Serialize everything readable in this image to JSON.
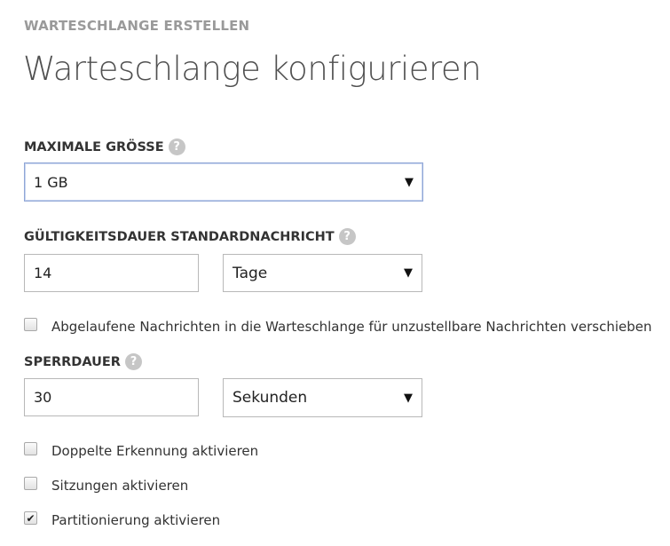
{
  "header": {
    "eyebrow": "WARTESCHLANGE ERSTELLEN",
    "title": "Warteschlange konfigurieren"
  },
  "max_size": {
    "label": "MAXIMALE GRÖSSE",
    "help": "?",
    "value": "1 GB",
    "caret": "▼"
  },
  "ttl": {
    "label": "GÜLTIGKEITSDAUER STANDARDNACHRICHT",
    "help": "?",
    "value": "14",
    "unit": "Tage",
    "caret": "▼"
  },
  "dead_letter": {
    "label": "Abgelaufene Nachrichten in die Warteschlange für unzustellbare Nachrichten verschieben",
    "checked": false
  },
  "lock": {
    "label": "SPERRDAUER",
    "help": "?",
    "value": "30",
    "unit": "Sekunden",
    "caret": "▼"
  },
  "options": [
    {
      "label": "Doppelte Erkennung aktivieren",
      "checked": false
    },
    {
      "label": "Sitzungen aktivieren",
      "checked": false
    },
    {
      "label": "Partitionierung aktivieren",
      "checked": true,
      "mark": "✔"
    }
  ]
}
